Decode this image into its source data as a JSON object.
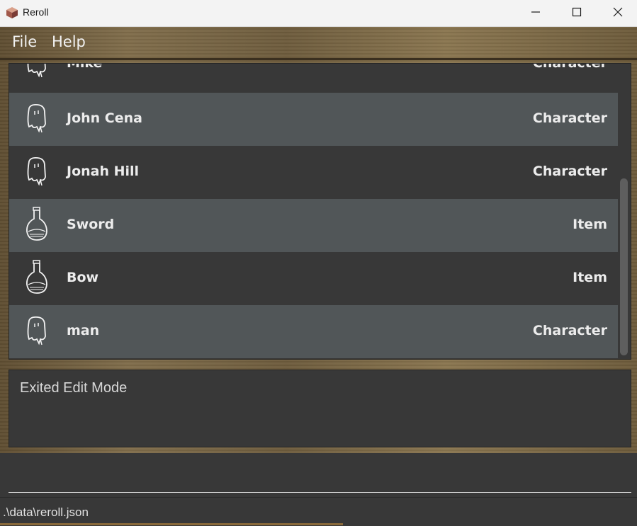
{
  "window": {
    "title": "Reroll",
    "controls": [
      "minimize-icon",
      "maximize-icon",
      "close-icon"
    ]
  },
  "menu": {
    "items": [
      {
        "label": "File"
      },
      {
        "label": "Help"
      }
    ]
  },
  "entity_list": {
    "rows": [
      {
        "name": "Mike",
        "type": "Character",
        "icon": "character-ghost-icon"
      },
      {
        "name": "John Cena",
        "type": "Character",
        "icon": "character-ghost-icon"
      },
      {
        "name": "Jonah Hill",
        "type": "Character",
        "icon": "character-ghost-icon"
      },
      {
        "name": "Sword",
        "type": "Item",
        "icon": "potion-flask-icon"
      },
      {
        "name": "Bow",
        "type": "Item",
        "icon": "potion-flask-icon"
      },
      {
        "name": "man",
        "type": "Character",
        "icon": "character-ghost-icon"
      }
    ]
  },
  "result_display": {
    "text": "Exited Edit Mode"
  },
  "command_box": {
    "value": "",
    "placeholder": ""
  },
  "status_bar": {
    "file_path": ".\\data\\reroll.json"
  },
  "colors": {
    "panel_bg": "#383838",
    "row_alt_bg": "#515658",
    "text": "#ececec"
  }
}
